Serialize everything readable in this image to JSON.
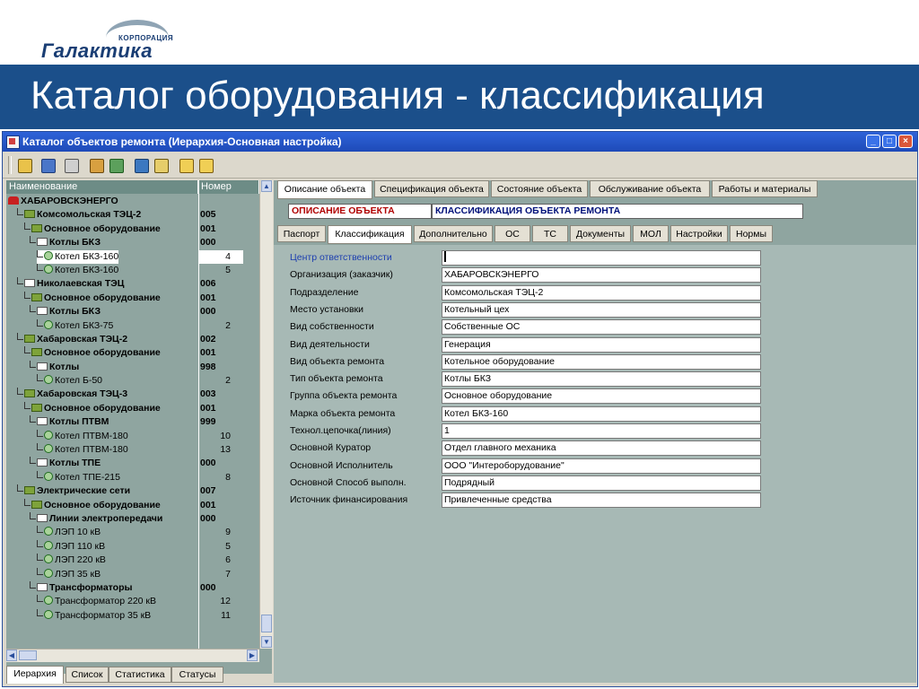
{
  "slide": {
    "logo_corp": "КОРПОРАЦИЯ",
    "logo_name": "Галактика",
    "title": "Каталог оборудования - классификация",
    "colors": {
      "header_blue": "#1b4f8a",
      "panel_teal": "#8fa5a0"
    }
  },
  "window": {
    "title": "Каталог объектов ремонта (Иерархия-Основная настройка)",
    "controls": [
      "_",
      "□",
      "×"
    ]
  },
  "toolbar": {
    "icons": [
      "edit-icon",
      "calc-icon",
      "print-icon",
      "copy-icon",
      "transfer-icon",
      "structure-icon",
      "list-icon",
      "folder-open-icon",
      "folder-up-icon"
    ]
  },
  "tree": {
    "headers": {
      "name": "Наименование",
      "number": "Номер"
    },
    "rows": [
      {
        "name": "ХАБАРОВСКЭНЕРГО",
        "num": "",
        "level": 0,
        "icon": "red",
        "bold": true
      },
      {
        "name": "Комсомольская ТЭЦ-2",
        "num": "005",
        "level": 1,
        "icon": "folder-g",
        "bold": true
      },
      {
        "name": "Основное оборудование",
        "num": "001",
        "level": 2,
        "icon": "folder-g",
        "bold": true
      },
      {
        "name": "Котлы БКЗ",
        "num": "000",
        "level": 3,
        "icon": "folder-w",
        "bold": true
      },
      {
        "name": "Котел БКЗ-160",
        "num": "4",
        "level": 4,
        "icon": "circ",
        "bold": false,
        "selected": true
      },
      {
        "name": "Котел БКЗ-160",
        "num": "5",
        "level": 4,
        "icon": "circ",
        "bold": false
      },
      {
        "name": "Николаевская ТЭЦ",
        "num": "006",
        "level": 1,
        "icon": "folder-w",
        "bold": true
      },
      {
        "name": "Основное оборудование",
        "num": "001",
        "level": 2,
        "icon": "folder-g",
        "bold": true
      },
      {
        "name": "Котлы БКЗ",
        "num": "000",
        "level": 3,
        "icon": "folder-w",
        "bold": true
      },
      {
        "name": "Котел БКЗ-75",
        "num": "2",
        "level": 4,
        "icon": "circ",
        "bold": false
      },
      {
        "name": "Хабаровская ТЭЦ-2",
        "num": "002",
        "level": 1,
        "icon": "folder-g",
        "bold": true
      },
      {
        "name": "Основное оборудование",
        "num": "001",
        "level": 2,
        "icon": "folder-g",
        "bold": true
      },
      {
        "name": "Котлы",
        "num": "998",
        "level": 3,
        "icon": "folder-w",
        "bold": true
      },
      {
        "name": "Котел Б-50",
        "num": "2",
        "level": 4,
        "icon": "circ",
        "bold": false
      },
      {
        "name": "Хабаровская ТЭЦ-3",
        "num": "003",
        "level": 1,
        "icon": "folder-g",
        "bold": true
      },
      {
        "name": "Основное оборудование",
        "num": "001",
        "level": 2,
        "icon": "folder-g",
        "bold": true
      },
      {
        "name": "Котлы ПТВМ",
        "num": "999",
        "level": 3,
        "icon": "folder-w",
        "bold": true
      },
      {
        "name": "Котел ПТВМ-180",
        "num": "10",
        "level": 4,
        "icon": "circ",
        "bold": false
      },
      {
        "name": "Котел ПТВМ-180",
        "num": "13",
        "level": 4,
        "icon": "circ",
        "bold": false
      },
      {
        "name": "Котлы ТПЕ",
        "num": "000",
        "level": 3,
        "icon": "folder-w",
        "bold": true
      },
      {
        "name": "Котел ТПЕ-215",
        "num": "8",
        "level": 4,
        "icon": "circ",
        "bold": false
      },
      {
        "name": "Электрические сети",
        "num": "007",
        "level": 1,
        "icon": "folder-g",
        "bold": true
      },
      {
        "name": "Основное оборудование",
        "num": "001",
        "level": 2,
        "icon": "folder-g",
        "bold": true
      },
      {
        "name": "Линии электропередачи",
        "num": "000",
        "level": 3,
        "icon": "folder-w",
        "bold": true
      },
      {
        "name": "ЛЭП 10 кВ",
        "num": "9",
        "level": 4,
        "icon": "circ",
        "bold": false
      },
      {
        "name": "ЛЭП 110 кВ",
        "num": "5",
        "level": 4,
        "icon": "circ",
        "bold": false
      },
      {
        "name": "ЛЭП 220 кВ",
        "num": "6",
        "level": 4,
        "icon": "circ",
        "bold": false
      },
      {
        "name": "ЛЭП 35 кВ",
        "num": "7",
        "level": 4,
        "icon": "circ",
        "bold": false
      },
      {
        "name": "Трансформаторы",
        "num": "000",
        "level": 3,
        "icon": "folder-w",
        "bold": true
      },
      {
        "name": "Трансформатор 220 кВ",
        "num": "12",
        "level": 4,
        "icon": "circ",
        "bold": false
      },
      {
        "name": "Трансформатор 35 кВ",
        "num": "11",
        "level": 4,
        "icon": "circ",
        "bold": false
      }
    ]
  },
  "bottom_tabs": [
    "Иерархия",
    "Список",
    "Статистика",
    "Статусы"
  ],
  "top_tabs": [
    "Описание объекта",
    "Спецификация объекта",
    "Состояние объекта",
    "Обслуживание объекта",
    "Работы и материалы"
  ],
  "section": {
    "left": "ОПИСАНИЕ ОБЪЕКТА",
    "right": "КЛАССИФИКАЦИЯ ОБЪЕКТА РЕМОНТА"
  },
  "sub_tabs": [
    "Паспорт",
    "Классификация",
    "Дополнительно",
    "ОС",
    "ТС",
    "Документы",
    "МОЛ",
    "Настройки",
    "Нормы"
  ],
  "form": [
    {
      "label": "Центр ответственности",
      "value": ""
    },
    {
      "label": "Организация (заказчик)",
      "value": "ХАБАРОВСКЭНЕРГО"
    },
    {
      "label": "Подразделение",
      "value": "Комсомольская ТЭЦ-2"
    },
    {
      "label": "Место установки",
      "value": "Котельный цех"
    },
    {
      "label": "Вид собственности",
      "value": "Собственные ОС"
    },
    {
      "label": "Вид деятельности",
      "value": "Генерация"
    },
    {
      "label": "Вид объекта ремонта",
      "value": "Котельное оборудование"
    },
    {
      "label": "Тип объекта ремонта",
      "value": "Котлы БКЗ"
    },
    {
      "label": "Группа объекта ремонта",
      "value": "Основное оборудование"
    },
    {
      "label": "Марка объекта ремонта",
      "value": "Котел БКЗ-160"
    },
    {
      "label": "Технол.цепочка(линия)",
      "value": "1"
    },
    {
      "label": "Основной Куратор",
      "value": "Отдел главного механика"
    },
    {
      "label": "Основной Исполнитель",
      "value": "ООО \"Интероборудование\""
    },
    {
      "label": "Основной Способ выполн.",
      "value": "Подрядный"
    },
    {
      "label": "Источник финансирования",
      "value": "Привлеченные средства"
    }
  ]
}
